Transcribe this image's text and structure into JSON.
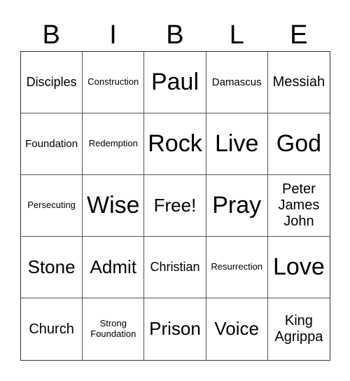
{
  "card": {
    "header": [
      "B",
      "I",
      "B",
      "L",
      "E"
    ],
    "rows": [
      [
        "Disciples",
        "Construction",
        "Paul",
        "Damascus",
        "Messiah"
      ],
      [
        "Foundation",
        "Redemption",
        "Rock",
        "Live",
        "God"
      ],
      [
        "Persecuting",
        "Wise",
        "Free!",
        "Pray",
        "Peter James John"
      ],
      [
        "Stone",
        "Admit",
        "Christian",
        "Resurrection",
        "Love"
      ],
      [
        "Church",
        "Strong Foundation",
        "Prison",
        "Voice",
        "King Agrippa"
      ]
    ]
  }
}
